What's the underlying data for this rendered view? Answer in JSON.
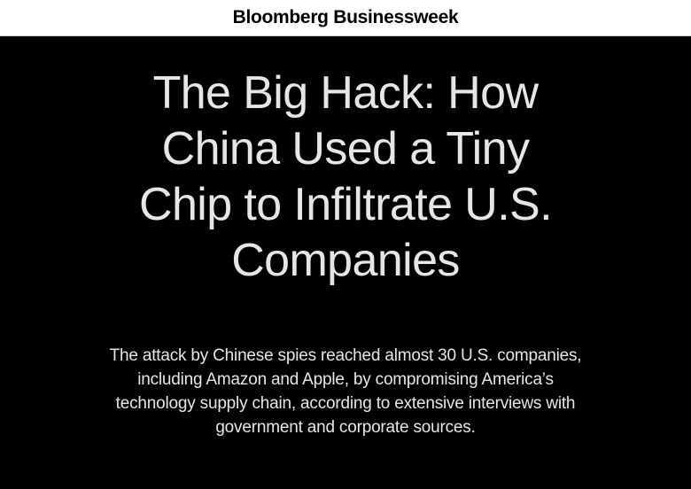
{
  "masthead": {
    "brand": "Bloomberg Businessweek"
  },
  "article": {
    "headline_lines": [
      "The Big Hack: How",
      "China Used a Tiny",
      "Chip to Infiltrate U.S.",
      "Companies"
    ],
    "dek_lines": [
      "The attack by Chinese spies reached almost 30 U.S. companies,",
      "including Amazon and Apple, by compromising America’s",
      "technology supply chain, according to extensive interviews with",
      "government and corporate sources."
    ]
  },
  "colors": {
    "background": "#000000",
    "masthead_background": "#ffffff",
    "text": "#e6e6e6"
  }
}
